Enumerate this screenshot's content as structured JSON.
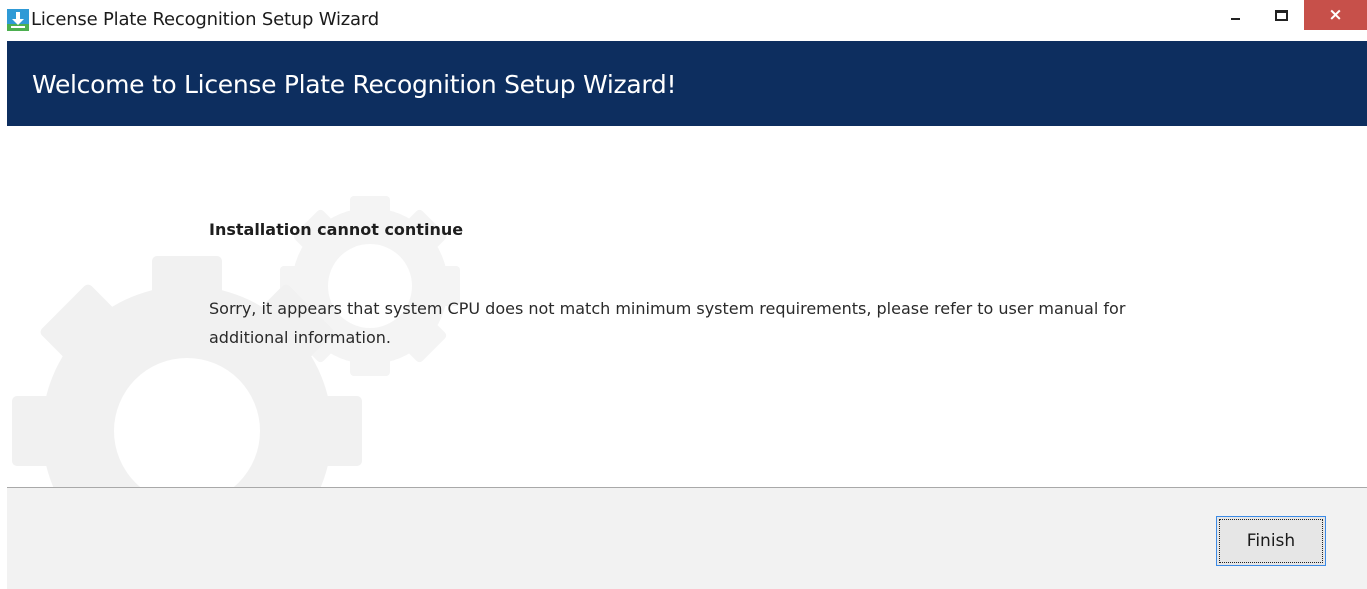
{
  "window": {
    "title": "License Plate Recognition Setup Wizard",
    "app_icon": "download-installer-icon",
    "controls": {
      "minimize_icon": "minimize-icon",
      "maximize_icon": "maximize-icon",
      "close_icon": "close-icon",
      "close_glyph": "×"
    }
  },
  "header": {
    "title": "Welcome to License Plate Recognition Setup Wizard!"
  },
  "content": {
    "heading": "Installation cannot continue",
    "message": "Sorry, it appears that system CPU does not match minimum system requirements, please refer to user manual for additional information.",
    "background_icon": "gears-icon"
  },
  "footer": {
    "finish_label": "Finish"
  },
  "colors": {
    "header_bg": "#0d2e5f",
    "close_bg": "#c7504a",
    "footer_bg": "#f2f2f2",
    "button_focus_border": "#3b8ae6"
  }
}
